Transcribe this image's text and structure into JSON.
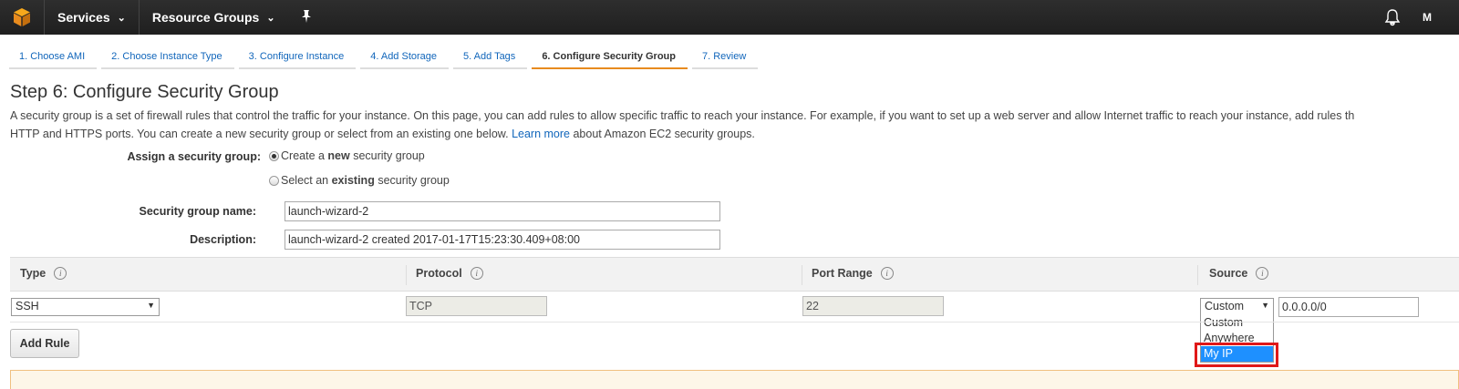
{
  "nav": {
    "services": "Services",
    "resource_groups": "Resource Groups",
    "user_initial": "M"
  },
  "tabs": [
    {
      "label": "1. Choose AMI"
    },
    {
      "label": "2. Choose Instance Type"
    },
    {
      "label": "3. Configure Instance"
    },
    {
      "label": "4. Add Storage"
    },
    {
      "label": "5. Add Tags"
    },
    {
      "label": "6. Configure Security Group"
    },
    {
      "label": "7. Review"
    }
  ],
  "page": {
    "title": "Step 6: Configure Security Group",
    "desc_line1": "A security group is a set of firewall rules that control the traffic for your instance. On this page, you can add rules to allow specific traffic to reach your instance. For example, if you want to set up a web server and allow Internet traffic to reach your instance, add rules th",
    "desc_line2_pre": "HTTP and HTTPS ports. You can create a new security group or select from an existing one below.",
    "desc_link": "Learn more",
    "desc_line2_post": "about Amazon EC2 security groups."
  },
  "form": {
    "assign_label": "Assign a security group:",
    "option_new_pre": "Create a ",
    "option_new_bold": "new",
    "option_new_post": " security group",
    "option_existing_pre": "Select an ",
    "option_existing_bold": "existing",
    "option_existing_post": " security group",
    "name_label": "Security group name:",
    "name_value": "launch-wizard-2",
    "desc_label": "Description:",
    "desc_value": "launch-wizard-2 created 2017-01-17T15:23:30.409+08:00"
  },
  "table": {
    "headers": {
      "type": "Type",
      "protocol": "Protocol",
      "port_range": "Port Range",
      "source": "Source"
    },
    "row": {
      "type": "SSH",
      "protocol": "TCP",
      "port_range": "22",
      "source_select": "Custom",
      "source_cidr": "0.0.0.0/0"
    },
    "source_options": [
      "Custom",
      "Anywhere",
      "My IP"
    ],
    "source_highlighted": "My IP"
  },
  "buttons": {
    "add_rule": "Add Rule"
  },
  "icons": {
    "info": "i"
  }
}
